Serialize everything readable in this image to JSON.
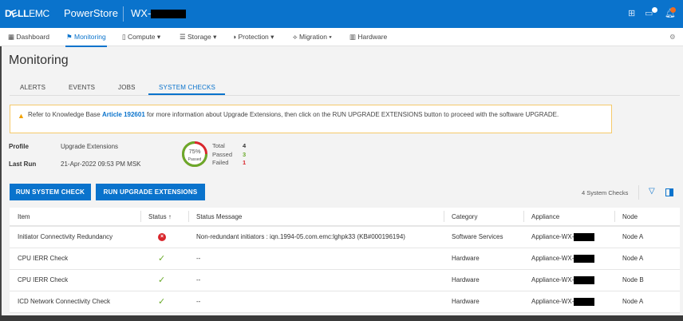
{
  "header": {
    "brand": "DELLEMC",
    "product": "PowerStore",
    "system": "WX-",
    "icons": [
      "grid-icon",
      "chat-icon",
      "bell-icon"
    ],
    "accent": "#0a73cc"
  },
  "nav": {
    "items": [
      {
        "label": "Dashboard",
        "icon": "dashboard-icon"
      },
      {
        "label": "Monitoring",
        "icon": "flag-icon",
        "active": true
      },
      {
        "label": "Compute ▾",
        "icon": "compute-icon"
      },
      {
        "label": "Storage ▾",
        "icon": "storage-icon"
      },
      {
        "label": "Protection ▾",
        "icon": "shield-icon"
      },
      {
        "label": "Migration ▾",
        "icon": "migration-icon"
      },
      {
        "label": "Hardware",
        "icon": "hardware-icon"
      }
    ]
  },
  "page": {
    "title": "Monitoring"
  },
  "tabs": [
    "ALERTS",
    "EVENTS",
    "JOBS",
    "SYSTEM CHECKS"
  ],
  "alert": {
    "pre": "Refer to Knowledge Base ",
    "link": "Article 192601",
    "post": " for more information about Upgrade Extensions, then click on the RUN UPGRADE EXTENSIONS button to proceed with the software UPGRADE."
  },
  "summary": {
    "profile_label": "Profile",
    "profile": "Upgrade Extensions",
    "lastrun_label": "Last Run",
    "lastrun": "21-Apr-2022 09:53 PM MSK",
    "percent": "75%",
    "percent_label": "Passed",
    "pass_fraction": 0.75,
    "total_label": "Total",
    "total": "4",
    "passed_label": "Passed",
    "passed": "3",
    "failed_label": "Failed",
    "failed": "1"
  },
  "buttons": {
    "run_check": "RUN SYSTEM CHECK",
    "run_upgrade": "RUN UPGRADE EXTENSIONS"
  },
  "table": {
    "count": "4 System Checks",
    "columns": [
      "Item",
      "Status ↑",
      "Status Message",
      "Category",
      "Appliance",
      "Node"
    ],
    "rows": [
      {
        "item": "Initiator Connectivity Redundancy",
        "status": "error",
        "message": "Non-redundant initiators : iqn.1994-05.com.emc:lghpk33 (KB#000196194)",
        "category": "Software Services",
        "appliance": "Appliance-WX-",
        "node": "Node A"
      },
      {
        "item": "CPU IERR Check",
        "status": "ok",
        "message": "--",
        "category": "Hardware",
        "appliance": "Appliance-WX-",
        "node": "Node A"
      },
      {
        "item": "CPU IERR Check",
        "status": "ok",
        "message": "--",
        "category": "Hardware",
        "appliance": "Appliance-WX-",
        "node": "Node B"
      },
      {
        "item": "ICD Network Connectivity Check",
        "status": "ok",
        "message": "--",
        "category": "Hardware",
        "appliance": "Appliance-WX-",
        "node": "Node A"
      }
    ]
  }
}
